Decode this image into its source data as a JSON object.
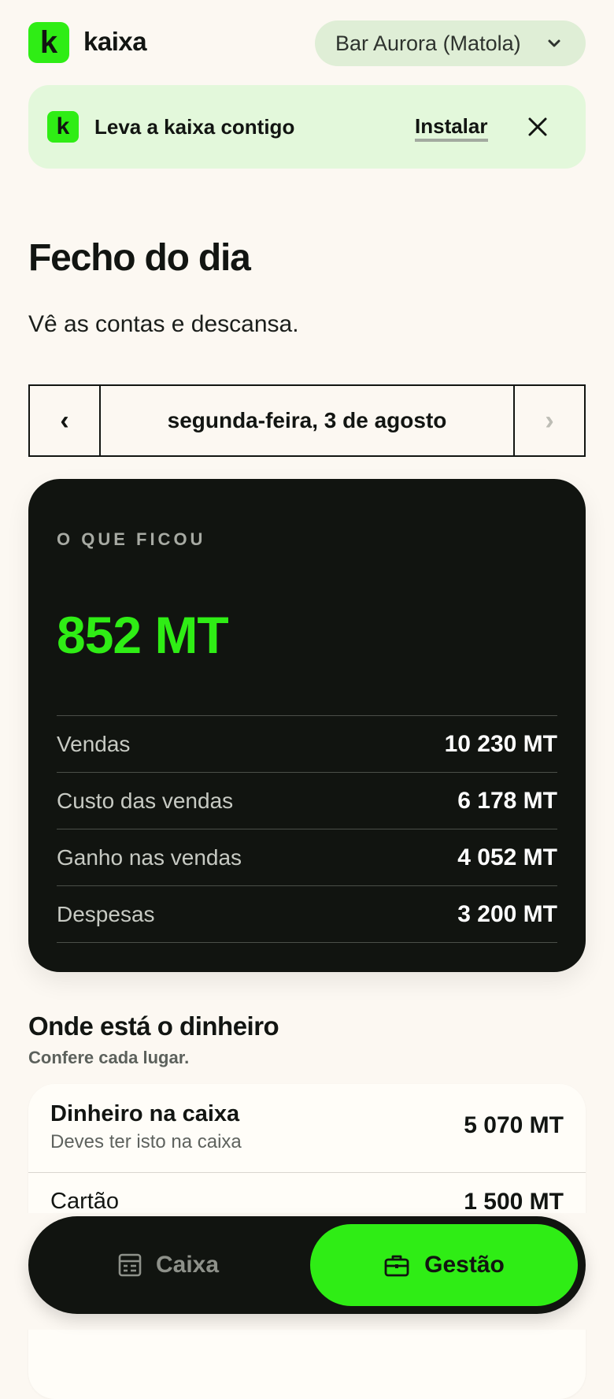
{
  "brand": {
    "logo_letter": "k",
    "name": "kaixa"
  },
  "venue": {
    "label": "Bar Aurora (Matola)",
    "icon": "chevron-down-icon"
  },
  "install_banner": {
    "logo_letter": "k",
    "text": "Leva a kaixa contigo",
    "install_label": "Instalar",
    "close_icon": "close-icon"
  },
  "page": {
    "title": "Fecho do dia",
    "subtitle": "Vê as contas e descansa."
  },
  "date_nav": {
    "prev": "‹",
    "date": "segunda-feira, 3 de agosto",
    "next": "›"
  },
  "summary": {
    "label": "O QUE FICOU",
    "value": "852 MT",
    "rows": [
      {
        "label": "Vendas",
        "value": "10 230 MT"
      },
      {
        "label": "Custo das vendas",
        "value": "6 178 MT"
      },
      {
        "label": "Ganho nas vendas",
        "value": "4 052 MT"
      },
      {
        "label": "Despesas",
        "value": "3 200 MT"
      }
    ]
  },
  "money_section": {
    "title": "Onde está o dinheiro",
    "subtitle": "Confere cada lugar.",
    "items": [
      {
        "name": "Dinheiro na caixa",
        "hint": "Deves ter isto na caixa",
        "value": "5 070 MT"
      },
      {
        "name": "Cartão",
        "value": "1 500 MT"
      }
    ]
  },
  "tabs": [
    {
      "label": "Caixa",
      "icon": "register-icon",
      "active": false
    },
    {
      "label": "Gestão",
      "icon": "briefcase-icon",
      "active": true
    }
  ],
  "colors": {
    "accent": "#2fed15",
    "dark": "#111410",
    "background": "#fcf8f2",
    "banner": "#e3f8db"
  }
}
